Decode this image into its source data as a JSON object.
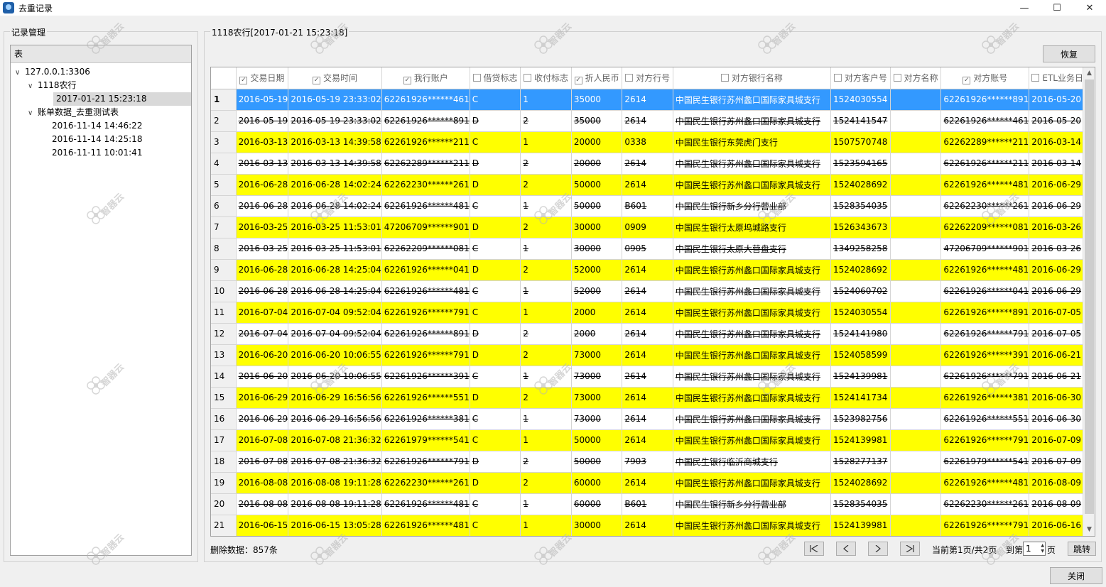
{
  "window": {
    "title": "去重记录",
    "min": "—",
    "max": "☐",
    "close": "✕"
  },
  "left_group": {
    "title": "记录管理"
  },
  "tree": {
    "header": "表",
    "nodes": [
      {
        "label": "127.0.0.1:3306",
        "level": 0,
        "expanded": true
      },
      {
        "label": "1118农行",
        "level": 1,
        "expanded": true
      },
      {
        "label": "2017-01-21 15:23:18",
        "level": 2,
        "selected": true
      },
      {
        "label": "账单数据_去重测试表",
        "level": 1,
        "expanded": true
      },
      {
        "label": "2016-11-14 14:46:22",
        "level": 2
      },
      {
        "label": "2016-11-14 14:25:18",
        "level": 2
      },
      {
        "label": "2016-11-11 10:01:41",
        "level": 2
      }
    ]
  },
  "right_group": {
    "title": "1118农行[2017-01-21 15:23:18]"
  },
  "restore_button": "恢复",
  "columns": [
    {
      "label": "交易日期",
      "checked": true
    },
    {
      "label": "交易时间",
      "checked": true
    },
    {
      "label": "我行账户",
      "checked": true
    },
    {
      "label": "借贷标志",
      "checked": false
    },
    {
      "label": "收付标志",
      "checked": false
    },
    {
      "label": "折人民币",
      "checked": true
    },
    {
      "label": "对方行号",
      "checked": false
    },
    {
      "label": "对方银行名称",
      "checked": false
    },
    {
      "label": "对方客户号",
      "checked": false
    },
    {
      "label": "对方名称",
      "checked": false
    },
    {
      "label": "对方账号",
      "checked": true
    },
    {
      "label": "ETL业务日期",
      "checked": false
    }
  ],
  "rows": [
    {
      "n": "1",
      "style": "sel",
      "cells": [
        "2016-05-19",
        "2016-05-19 23:33:02",
        "62261926******461",
        "C",
        "1",
        "35000",
        "2614",
        "中国民生银行苏州蠡口国际家具城支行",
        "1524030554",
        "",
        "62261926******891",
        "2016-05-20"
      ]
    },
    {
      "n": "2",
      "style": "dup",
      "cells": [
        "2016-05-19",
        "2016-05-19 23:33:02",
        "62261926******891",
        "D",
        "2",
        "35000",
        "2614",
        "中国民生银行苏州蠡口国际家具城支行",
        "1524141547",
        "",
        "62261926******461",
        "2016-05-20"
      ]
    },
    {
      "n": "3",
      "style": "yel",
      "cells": [
        "2016-03-13",
        "2016-03-13 14:39:58",
        "62261926******211",
        "C",
        "1",
        "20000",
        "0338",
        "中国民生银行东莞虎门支行",
        "1507570748",
        "",
        "62262289******211",
        "2016-03-14"
      ]
    },
    {
      "n": "4",
      "style": "dup",
      "cells": [
        "2016-03-13",
        "2016-03-13 14:39:58",
        "62262289******211",
        "D",
        "2",
        "20000",
        "2614",
        "中国民生银行苏州蠡口国际家具城支行",
        "1523594165",
        "",
        "62261926******211",
        "2016-03-14"
      ]
    },
    {
      "n": "5",
      "style": "yel",
      "cells": [
        "2016-06-28",
        "2016-06-28 14:02:24",
        "62262230******261",
        "D",
        "2",
        "50000",
        "2614",
        "中国民生银行苏州蠡口国际家具城支行",
        "1524028692",
        "",
        "62261926******481",
        "2016-06-29"
      ]
    },
    {
      "n": "6",
      "style": "dup",
      "cells": [
        "2016-06-28",
        "2016-06-28 14:02:24",
        "62261926******481",
        "C",
        "1",
        "50000",
        "B601",
        "中国民生银行新乡分行营业部",
        "1528354035",
        "",
        "62262230******261",
        "2016-06-29"
      ]
    },
    {
      "n": "7",
      "style": "yel",
      "cells": [
        "2016-03-25",
        "2016-03-25 11:53:01",
        "47206709******901",
        "D",
        "2",
        "30000",
        "0909",
        "中国民生银行太原坞城路支行",
        "1526343673",
        "",
        "62262209******081",
        "2016-03-26"
      ]
    },
    {
      "n": "8",
      "style": "dup",
      "cells": [
        "2016-03-25",
        "2016-03-25 11:53:01",
        "62262209******081",
        "C",
        "1",
        "30000",
        "0905",
        "中国民生银行太原大营盘支行",
        "1349258258",
        "",
        "47206709******901",
        "2016-03-26"
      ]
    },
    {
      "n": "9",
      "style": "yel",
      "cells": [
        "2016-06-28",
        "2016-06-28 14:25:04",
        "62261926******041",
        "D",
        "2",
        "52000",
        "2614",
        "中国民生银行苏州蠡口国际家具城支行",
        "1524028692",
        "",
        "62261926******481",
        "2016-06-29"
      ]
    },
    {
      "n": "10",
      "style": "dup",
      "cells": [
        "2016-06-28",
        "2016-06-28 14:25:04",
        "62261926******481",
        "C",
        "1",
        "52000",
        "2614",
        "中国民生银行苏州蠡口国际家具城支行",
        "1524060702",
        "",
        "62261926******041",
        "2016-06-29"
      ]
    },
    {
      "n": "11",
      "style": "yel",
      "cells": [
        "2016-07-04",
        "2016-07-04 09:52:04",
        "62261926******791",
        "C",
        "1",
        "2000",
        "2614",
        "中国民生银行苏州蠡口国际家具城支行",
        "1524030554",
        "",
        "62261926******891",
        "2016-07-05"
      ]
    },
    {
      "n": "12",
      "style": "dup",
      "cells": [
        "2016-07-04",
        "2016-07-04 09:52:04",
        "62261926******891",
        "D",
        "2",
        "2000",
        "2614",
        "中国民生银行苏州蠡口国际家具城支行",
        "1524141980",
        "",
        "62261926******791",
        "2016-07-05"
      ]
    },
    {
      "n": "13",
      "style": "yel",
      "cells": [
        "2016-06-20",
        "2016-06-20 10:06:55",
        "62261926******791",
        "D",
        "2",
        "73000",
        "2614",
        "中国民生银行苏州蠡口国际家具城支行",
        "1524058599",
        "",
        "62261926******391",
        "2016-06-21"
      ]
    },
    {
      "n": "14",
      "style": "dup",
      "cells": [
        "2016-06-20",
        "2016-06-20 10:06:55",
        "62261926******391",
        "C",
        "1",
        "73000",
        "2614",
        "中国民生银行苏州蠡口国际家具城支行",
        "1524139981",
        "",
        "62261926******791",
        "2016-06-21"
      ]
    },
    {
      "n": "15",
      "style": "yel",
      "cells": [
        "2016-06-29",
        "2016-06-29 16:56:56",
        "62261926******551",
        "D",
        "2",
        "73000",
        "2614",
        "中国民生银行苏州蠡口国际家具城支行",
        "1524141734",
        "",
        "62261926******381",
        "2016-06-30"
      ]
    },
    {
      "n": "16",
      "style": "dup",
      "cells": [
        "2016-06-29",
        "2016-06-29 16:56:56",
        "62261926******381",
        "C",
        "1",
        "73000",
        "2614",
        "中国民生银行苏州蠡口国际家具城支行",
        "1523982756",
        "",
        "62261926******551",
        "2016-06-30"
      ]
    },
    {
      "n": "17",
      "style": "yel",
      "cells": [
        "2016-07-08",
        "2016-07-08 21:36:32",
        "62261979******541",
        "C",
        "1",
        "50000",
        "2614",
        "中国民生银行苏州蠡口国际家具城支行",
        "1524139981",
        "",
        "62261926******791",
        "2016-07-09"
      ]
    },
    {
      "n": "18",
      "style": "dup",
      "cells": [
        "2016-07-08",
        "2016-07-08 21:36:32",
        "62261926******791",
        "D",
        "2",
        "50000",
        "7903",
        "中国民生银行临沂商城支行",
        "1528277137",
        "",
        "62261979******541",
        "2016-07-09"
      ]
    },
    {
      "n": "19",
      "style": "yel",
      "cells": [
        "2016-08-08",
        "2016-08-08 19:11:28",
        "62262230******261",
        "D",
        "2",
        "60000",
        "2614",
        "中国民生银行苏州蠡口国际家具城支行",
        "1524028692",
        "",
        "62261926******481",
        "2016-08-09"
      ]
    },
    {
      "n": "20",
      "style": "dup",
      "cells": [
        "2016-08-08",
        "2016-08-08 19:11:28",
        "62261926******481",
        "C",
        "1",
        "60000",
        "B601",
        "中国民生银行新乡分行营业部",
        "1528354035",
        "",
        "62262230******261",
        "2016-08-09"
      ]
    },
    {
      "n": "21",
      "style": "yel",
      "cells": [
        "2016-06-15",
        "2016-06-15 13:05:28",
        "62261926******481",
        "C",
        "1",
        "30000",
        "2614",
        "中国民生银行苏州蠡口国际家具城支行",
        "1524139981",
        "",
        "62261926******791",
        "2016-06-16"
      ]
    }
  ],
  "status": {
    "deleted": "删除数据：857条"
  },
  "pager": {
    "page_info": "当前第1页/共2页",
    "goto_prefix": "到第",
    "goto_value": "1",
    "goto_suffix": "页",
    "jump": "跳转"
  },
  "close_button": "关闭",
  "watermark": "智器云",
  "colors": {
    "selected": "#3399ff",
    "highlight": "#ffff00"
  }
}
